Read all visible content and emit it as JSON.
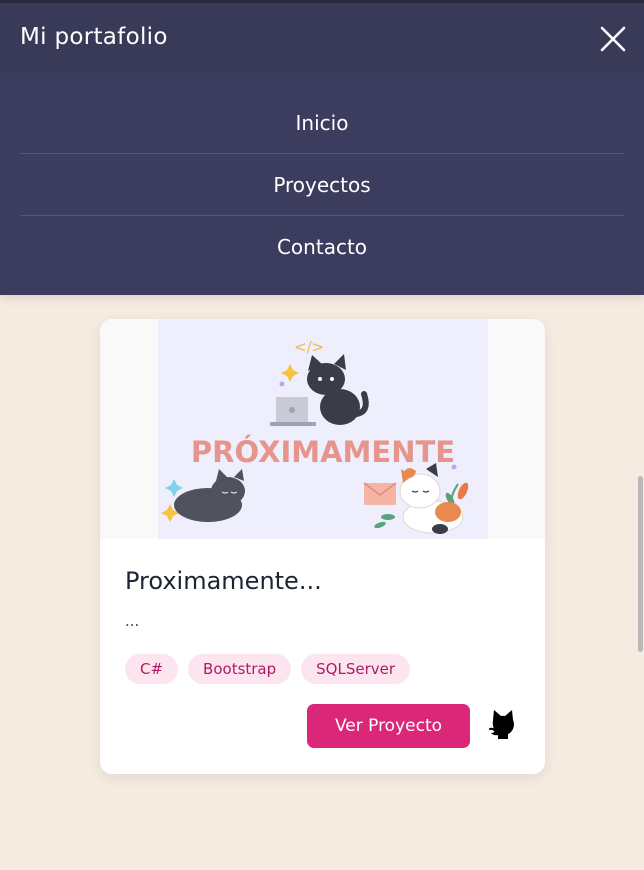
{
  "header": {
    "title": "Mi portafolio"
  },
  "nav": {
    "items": [
      {
        "label": "Inicio"
      },
      {
        "label": "Proyectos"
      },
      {
        "label": "Contacto"
      }
    ]
  },
  "project": {
    "image_text": "PRÓXIMAMENTE",
    "image_code_glyph": "</>",
    "title": "Proximamente...",
    "description": "...",
    "tags": [
      "C#",
      "Bootstrap",
      "SQLServer"
    ],
    "button_label": "Ver Proyecto",
    "icons": {
      "close": "close-icon",
      "repo": "github-icon"
    }
  },
  "colors": {
    "page_bg": "#f5ebe0",
    "menu_bg": "#3c3d5e",
    "accent": "#db2777",
    "tag_bg": "#fde5f0",
    "tag_text": "#b01b63",
    "image_bg": "#eeeefc",
    "image_text": "#e6958d"
  }
}
